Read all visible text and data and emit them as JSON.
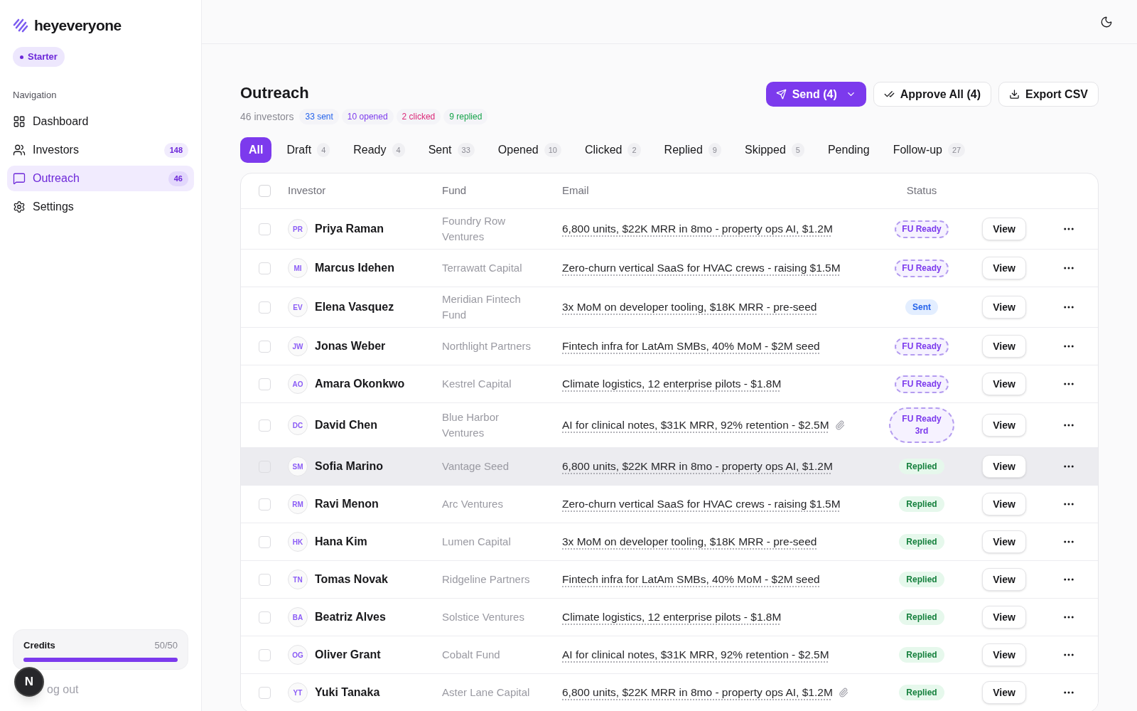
{
  "brand": {
    "name": "heyeveryone"
  },
  "plan": {
    "label": "Starter"
  },
  "sidebar": {
    "heading": "Navigation",
    "items": [
      {
        "kind": "dashboard",
        "label": "Dashboard",
        "selected": false
      },
      {
        "kind": "investors",
        "label": "Investors",
        "count": "148",
        "selected": false
      },
      {
        "kind": "outreach",
        "label": "Outreach",
        "count": "46",
        "selected": true
      },
      {
        "kind": "settings",
        "label": "Settings",
        "selected": false
      }
    ]
  },
  "credits": {
    "label": "Credits",
    "reading": "50/50",
    "level": 1
  },
  "avatar": {
    "initial": "N"
  },
  "logout": {
    "label": "og out"
  },
  "page": {
    "title": "Outreach",
    "summary": "46 investors",
    "stats": [
      {
        "label": "33 sent",
        "color": "#2563eb"
      },
      {
        "label": "10 opened",
        "color": "#7c3aed"
      },
      {
        "label": "2 clicked",
        "color": "#db2777"
      },
      {
        "label": "9 replied",
        "color": "#16a34a"
      }
    ]
  },
  "actions": {
    "send": "Send (4)",
    "approve": "Approve All (4)",
    "export": "Export CSV"
  },
  "tabs": [
    {
      "label": "All",
      "selected": true
    },
    {
      "label": "Draft",
      "count": "4",
      "selected": false
    },
    {
      "label": "Ready",
      "count": "4",
      "selected": false
    },
    {
      "label": "Sent",
      "count": "33",
      "selected": false
    },
    {
      "label": "Opened",
      "count": "10",
      "selected": false
    },
    {
      "label": "Clicked",
      "count": "2",
      "selected": false
    },
    {
      "label": "Replied",
      "count": "9",
      "selected": false
    },
    {
      "label": "Skipped",
      "count": "5",
      "selected": false
    },
    {
      "label": "Pending",
      "selected": false
    },
    {
      "label": "Follow-up",
      "count": "27",
      "selected": false
    }
  ],
  "table": {
    "select_all_checked": false,
    "columns": [
      "Investor",
      "Fund",
      "Email",
      "Status"
    ],
    "rows": [
      {
        "initials": "PR",
        "name": "Priya Raman",
        "fund": "Foundry Row Ventures",
        "email": "6,800 units, $22K MRR in 8mo - property ops AI, $1.2M",
        "attachment": false,
        "status": {
          "kind": "fu_ready",
          "label": "FU Ready"
        },
        "view": "View",
        "hovered": false,
        "checked": false
      },
      {
        "initials": "MI",
        "name": "Marcus Idehen",
        "fund": "Terrawatt Capital",
        "email": "Zero-churn vertical SaaS for HVAC crews - raising $1.5M",
        "attachment": false,
        "status": {
          "kind": "fu_ready",
          "label": "FU Ready"
        },
        "view": "View",
        "hovered": false,
        "checked": false
      },
      {
        "initials": "EV",
        "name": "Elena Vasquez",
        "fund": "Meridian Fintech Fund",
        "email": "3x MoM on developer tooling, $18K MRR - pre-seed",
        "attachment": false,
        "status": {
          "kind": "sent",
          "label": "Sent"
        },
        "view": "View",
        "hovered": false,
        "checked": false
      },
      {
        "initials": "JW",
        "name": "Jonas Weber",
        "fund": "Northlight Partners",
        "email": "Fintech infra for LatAm SMBs, 40% MoM - $2M seed",
        "attachment": false,
        "status": {
          "kind": "fu_ready",
          "label": "FU Ready"
        },
        "view": "View",
        "hovered": false,
        "checked": false
      },
      {
        "initials": "AO",
        "name": "Amara Okonkwo",
        "fund": "Kestrel Capital",
        "email": "Climate logistics, 12 enterprise pilots - $1.8M",
        "attachment": false,
        "status": {
          "kind": "fu_ready",
          "label": "FU Ready"
        },
        "view": "View",
        "hovered": false,
        "checked": false
      },
      {
        "initials": "DC",
        "name": "David Chen",
        "fund": "Blue Harbor Ventures",
        "email": "AI for clinical notes, $31K MRR, 92% retention - $2.5M",
        "attachment": true,
        "status": {
          "kind": "fu_ready",
          "label": "FU Ready",
          "sub": "3rd"
        },
        "view": "View",
        "hovered": false,
        "checked": false
      },
      {
        "initials": "SM",
        "name": "Sofia Marino",
        "fund": "Vantage Seed",
        "email": "6,800 units, $22K MRR in 8mo - property ops AI, $1.2M",
        "attachment": false,
        "status": {
          "kind": "replied",
          "label": "Replied"
        },
        "view": "View",
        "hovered": true,
        "checked": false
      },
      {
        "initials": "RM",
        "name": "Ravi Menon",
        "fund": "Arc Ventures",
        "email": "Zero-churn vertical SaaS for HVAC crews - raising $1.5M",
        "attachment": false,
        "status": {
          "kind": "replied",
          "label": "Replied"
        },
        "view": "View",
        "hovered": false,
        "checked": false
      },
      {
        "initials": "HK",
        "name": "Hana Kim",
        "fund": "Lumen Capital",
        "email": "3x MoM on developer tooling, $18K MRR - pre-seed",
        "attachment": false,
        "status": {
          "kind": "replied",
          "label": "Replied"
        },
        "view": "View",
        "hovered": false,
        "checked": false
      },
      {
        "initials": "TN",
        "name": "Tomas Novak",
        "fund": "Ridgeline Partners",
        "email": "Fintech infra for LatAm SMBs, 40% MoM - $2M seed",
        "attachment": false,
        "status": {
          "kind": "replied",
          "label": "Replied"
        },
        "view": "View",
        "hovered": false,
        "checked": false
      },
      {
        "initials": "BA",
        "name": "Beatriz Alves",
        "fund": "Solstice Ventures",
        "email": "Climate logistics, 12 enterprise pilots - $1.8M",
        "attachment": false,
        "status": {
          "kind": "replied",
          "label": "Replied"
        },
        "view": "View",
        "hovered": false,
        "checked": false
      },
      {
        "initials": "OG",
        "name": "Oliver Grant",
        "fund": "Cobalt Fund",
        "email": "AI for clinical notes, $31K MRR, 92% retention - $2.5M",
        "attachment": false,
        "status": {
          "kind": "replied",
          "label": "Replied"
        },
        "view": "View",
        "hovered": false,
        "checked": false
      },
      {
        "initials": "YT",
        "name": "Yuki Tanaka",
        "fund": "Aster Lane Capital",
        "email": "6,800 units, $22K MRR in 8mo - property ops AI, $1.2M",
        "attachment": true,
        "status": {
          "kind": "replied",
          "label": "Replied"
        },
        "view": "View",
        "hovered": false,
        "checked": false
      }
    ]
  }
}
